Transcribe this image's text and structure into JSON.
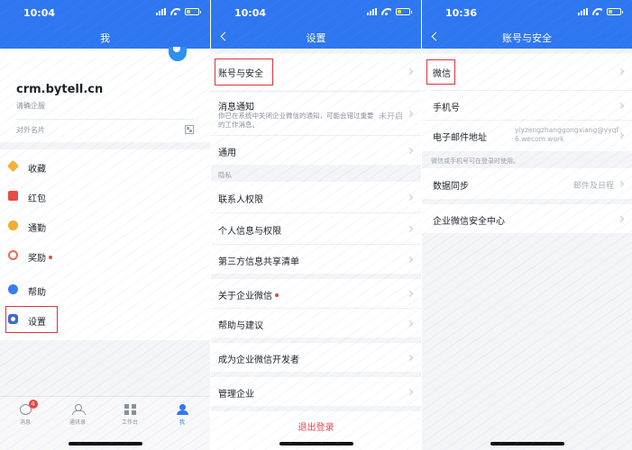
{
  "screen_me": {
    "status": {
      "time": "10:04"
    },
    "nav_title": "我",
    "profile": {
      "domain": "crm.bytell.cn",
      "subtitle": "请确企服",
      "card_label": "对外名片"
    },
    "menu": [
      {
        "label": "收藏",
        "icon": "star-icon",
        "dot": false
      },
      {
        "label": "红包",
        "icon": "red-packet-icon",
        "dot": false
      },
      {
        "label": "通勤",
        "icon": "commute-icon",
        "dot": false
      },
      {
        "label": "奖励",
        "icon": "reward-icon",
        "dot": true
      },
      {
        "label": "帮助",
        "icon": "help-icon",
        "dot": false
      },
      {
        "label": "设置",
        "icon": "settings-icon",
        "dot": false
      }
    ],
    "tabbar": [
      {
        "label": "消息",
        "badge": "4"
      },
      {
        "label": "通讯录"
      },
      {
        "label": "工作台"
      },
      {
        "label": "我"
      }
    ]
  },
  "screen_settings": {
    "status": {
      "time": "10:04"
    },
    "nav_title": "设置",
    "account_security": "账号与安全",
    "notification": {
      "label": "消息通知",
      "desc": "你已在系统中关闭企业微信的通知，可能会错过重要的工作消息。",
      "value": "未开启"
    },
    "general": "通用",
    "privacy_section": "隐私",
    "contacts_permission": "联系人权限",
    "personal_info": "个人信息与权限",
    "third_party": "第三方信息共享清单",
    "about": "关于企业微信",
    "feedback": "帮助与建议",
    "developer": "成为企业微信开发者",
    "manage_company": "管理企业",
    "logout": "退出登录"
  },
  "screen_account": {
    "status": {
      "time": "10:36"
    },
    "nav_title": "账号与安全",
    "wechat": "微信",
    "phone": "手机号",
    "email": {
      "label": "电子邮件地址",
      "value": "yiyzengzhanggongxiang@yyqf6.wecom.work"
    },
    "login_note": "微信或手机号可在登录时使用。",
    "data_sync": {
      "label": "数据同步",
      "value": "邮件及日程"
    },
    "security_center": "企业微信安全中心"
  },
  "colors": {
    "brand_blue": "#2e77f0",
    "highlight_red": "#e0303a",
    "danger_text": "#e0484a"
  }
}
